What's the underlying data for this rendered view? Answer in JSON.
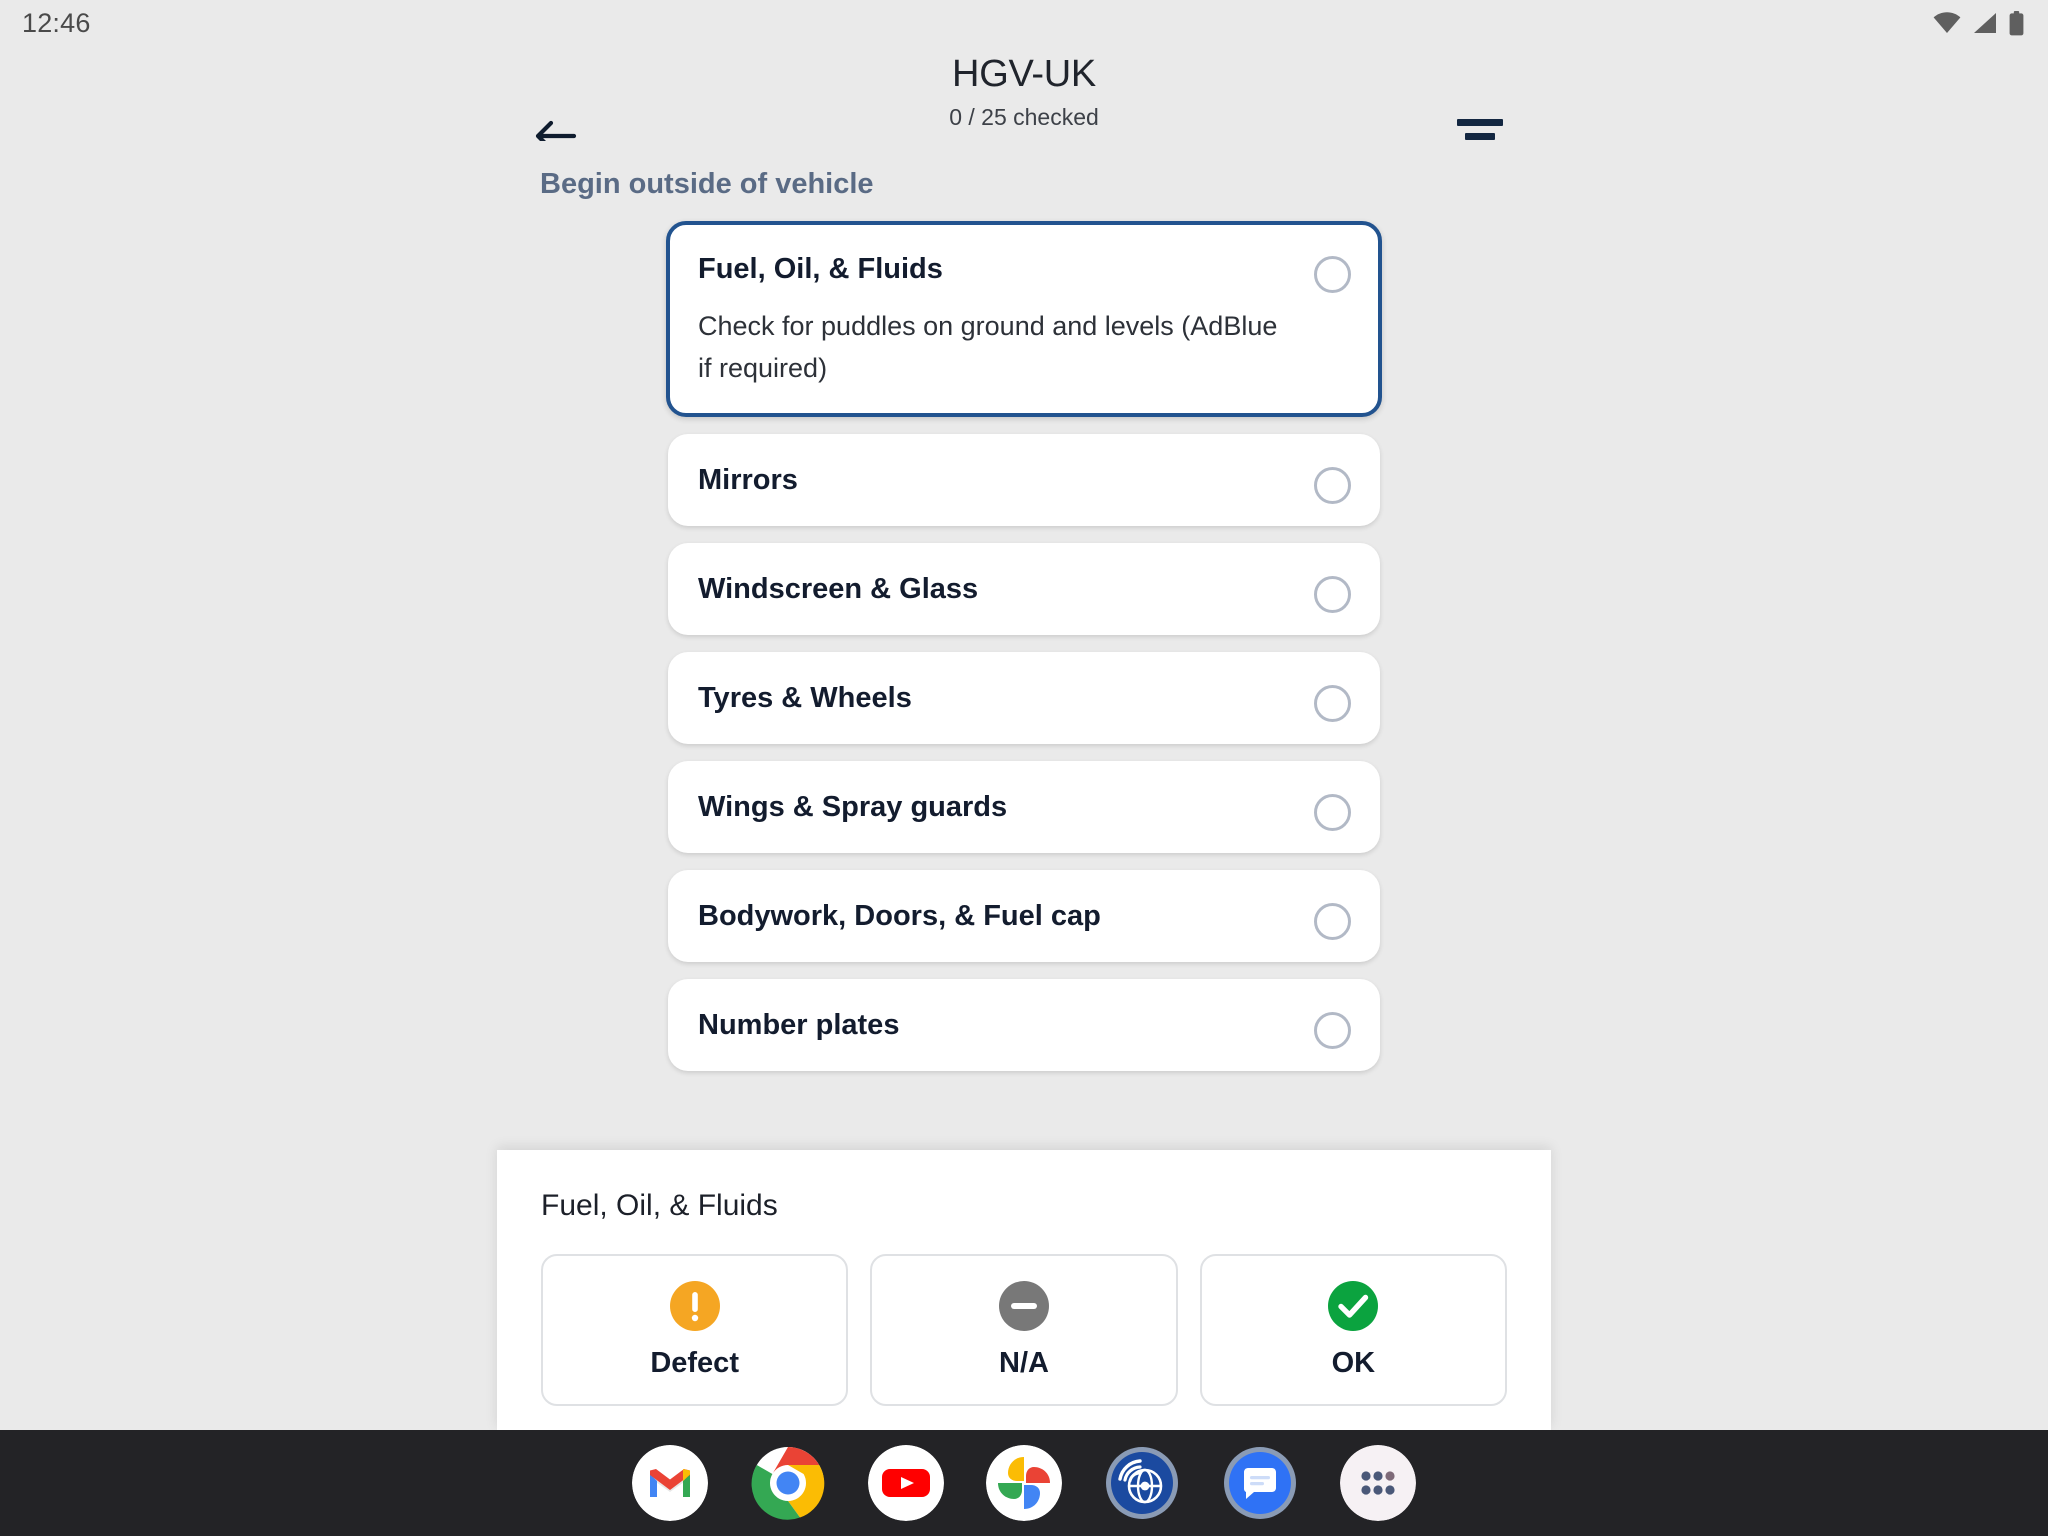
{
  "status_bar": {
    "time": "12:46",
    "icons": [
      "wifi-icon",
      "cellular-signal-icon",
      "battery-icon"
    ]
  },
  "header": {
    "back_icon": "arrow-left-icon",
    "title": "HGV-UK",
    "subtitle": "0 / 25 checked",
    "filter_icon": "filter-icon",
    "checked_count": 0,
    "total_count": 25
  },
  "checklist": {
    "section_label": "Begin outside of vehicle",
    "items": [
      {
        "title": "Fuel, Oil, & Fluids",
        "description": "Check for puddles on ground and levels (AdBlue if required)",
        "selected": true,
        "state": "unchecked"
      },
      {
        "title": "Mirrors",
        "description": "",
        "selected": false,
        "state": "unchecked"
      },
      {
        "title": "Windscreen & Glass",
        "description": "",
        "selected": false,
        "state": "unchecked"
      },
      {
        "title": "Tyres & Wheels",
        "description": "",
        "selected": false,
        "state": "unchecked"
      },
      {
        "title": "Wings & Spray guards",
        "description": "",
        "selected": false,
        "state": "unchecked"
      },
      {
        "title": "Bodywork, Doors, & Fuel cap",
        "description": "",
        "selected": false,
        "state": "unchecked"
      },
      {
        "title": "Number plates",
        "description": "",
        "selected": false,
        "state": "unchecked"
      }
    ]
  },
  "bottom_sheet": {
    "title": "Fuel, Oil, & Fluids",
    "actions": [
      {
        "label": "Defect",
        "icon": "exclamation-circle-icon",
        "color": "#f5a623"
      },
      {
        "label": "N/A",
        "icon": "minus-circle-icon",
        "color": "#787878"
      },
      {
        "label": "OK",
        "icon": "check-circle-icon",
        "color": "#0ba33f"
      }
    ]
  },
  "taskbar": {
    "apps": [
      {
        "name": "gmail-icon",
        "label": "Gmail"
      },
      {
        "name": "chrome-icon",
        "label": "Chrome"
      },
      {
        "name": "youtube-icon",
        "label": "YouTube"
      },
      {
        "name": "google-photos-icon",
        "label": "Photos"
      },
      {
        "name": "network-radar-icon",
        "label": "Network"
      },
      {
        "name": "messages-icon",
        "label": "Messages"
      },
      {
        "name": "app-drawer-icon",
        "label": "All apps"
      }
    ]
  },
  "colors": {
    "page_background": "#eaeaea",
    "card_background": "#ffffff",
    "selected_border": "#22538f",
    "section_label": "#5a6b85",
    "title_text": "#131c2e",
    "radio_outline": "#b2b9c6",
    "taskbar_background": "#232326"
  }
}
